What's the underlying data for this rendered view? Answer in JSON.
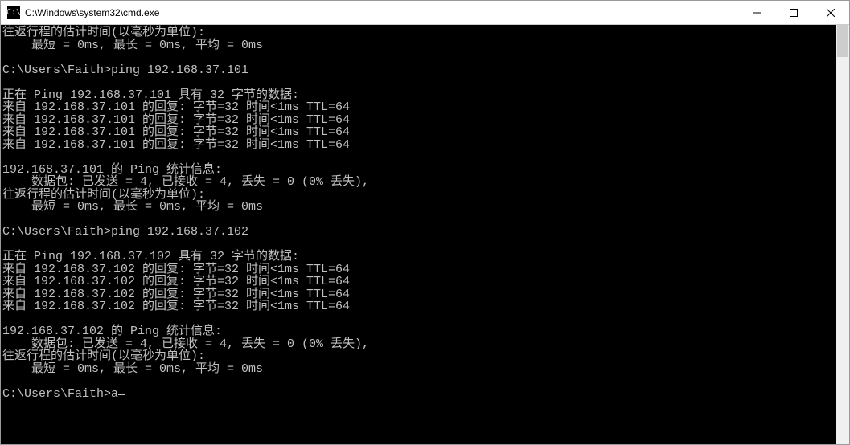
{
  "window": {
    "title": "C:\\Windows\\system32\\cmd.exe"
  },
  "terminal": {
    "lines": [
      "往返行程的估计时间(以毫秒为单位):",
      "    最短 = 0ms, 最长 = 0ms, 平均 = 0ms",
      "",
      "C:\\Users\\Faith>ping 192.168.37.101",
      "",
      "正在 Ping 192.168.37.101 具有 32 字节的数据:",
      "来自 192.168.37.101 的回复: 字节=32 时间<1ms TTL=64",
      "来自 192.168.37.101 的回复: 字节=32 时间<1ms TTL=64",
      "来自 192.168.37.101 的回复: 字节=32 时间<1ms TTL=64",
      "来自 192.168.37.101 的回复: 字节=32 时间<1ms TTL=64",
      "",
      "192.168.37.101 的 Ping 统计信息:",
      "    数据包: 已发送 = 4, 已接收 = 4, 丢失 = 0 (0% 丢失),",
      "往返行程的估计时间(以毫秒为单位):",
      "    最短 = 0ms, 最长 = 0ms, 平均 = 0ms",
      "",
      "C:\\Users\\Faith>ping 192.168.37.102",
      "",
      "正在 Ping 192.168.37.102 具有 32 字节的数据:",
      "来自 192.168.37.102 的回复: 字节=32 时间<1ms TTL=64",
      "来自 192.168.37.102 的回复: 字节=32 时间<1ms TTL=64",
      "来自 192.168.37.102 的回复: 字节=32 时间<1ms TTL=64",
      "来自 192.168.37.102 的回复: 字节=32 时间<1ms TTL=64",
      "",
      "192.168.37.102 的 Ping 统计信息:",
      "    数据包: 已发送 = 4, 已接收 = 4, 丢失 = 0 (0% 丢失),",
      "往返行程的估计时间(以毫秒为单位):",
      "    最短 = 0ms, 最长 = 0ms, 平均 = 0ms",
      ""
    ],
    "prompt": "C:\\Users\\Faith>",
    "typed": "a"
  }
}
